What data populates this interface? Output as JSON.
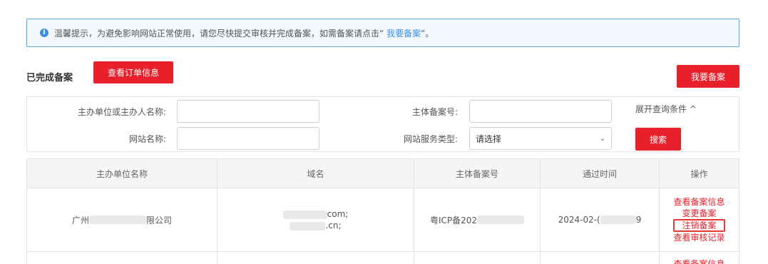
{
  "notice": {
    "text": "温馨提示，为避免影响网站正常使用，请您尽快提交审核并完成备案，如需备案请点击",
    "quote_open": "“",
    "link": "我要备案",
    "quote_close": "”。"
  },
  "section": {
    "title": "已完成备案",
    "order_button": "查看订单信息",
    "register_button": "我要备案"
  },
  "search": {
    "sponsor_label": "主办单位或主办人名称:",
    "record_no_label": "主体备案号:",
    "site_name_label": "网站名称:",
    "service_type_label": "网站服务类型:",
    "service_type_value": "请选择",
    "expand_label": "展开查询条件 ^",
    "search_button": "搜索"
  },
  "table": {
    "headers": [
      "主办单位名称",
      "域名",
      "主体备案号",
      "通过时间",
      "操作"
    ],
    "rows": [
      {
        "company_prefix": "广州",
        "company_suffix": "限公司",
        "domain_1": "com;",
        "domain_2": ".cn;",
        "record_prefix": "粤ICP备202",
        "date_prefix": "2024-02-(",
        "date_suffix": "9",
        "actions": [
          "查看备案信息",
          "变更备案",
          "注销备案",
          "查看审核记录"
        ]
      }
    ],
    "next_row_partial_action": "查看备案信息"
  },
  "colors": {
    "accent_red": "#e8202c",
    "info_blue": "#3d8fe0",
    "highlight_border": "#e53935"
  }
}
